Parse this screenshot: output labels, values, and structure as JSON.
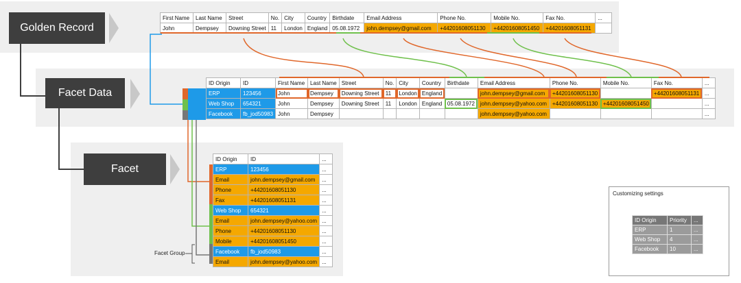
{
  "labels": {
    "golden": "Golden Record",
    "facet_data": "Facet Data",
    "facet": "Facet",
    "facet_group": "Facet Group"
  },
  "golden": {
    "headers": [
      "First Name",
      "Last Name",
      "Street",
      "No.",
      "City",
      "Country",
      "Birthdate",
      "Email Address",
      "Phone No.",
      "Mobile No.",
      "Fax No.",
      "..."
    ],
    "row": [
      "John",
      "Dempsey",
      "Downing Street",
      "11",
      "London",
      "England",
      "05.08.1972",
      "john.dempsey@gmail.com",
      "+44201608051130",
      "+44201608051450",
      "+44201608051131",
      ""
    ]
  },
  "facet_data": {
    "headers": [
      "ID Origin",
      "ID",
      "First Name",
      "Last Name",
      "Street",
      "No.",
      "City",
      "Country",
      "Birthdate",
      "Email Address",
      "Phone No.",
      "Mobile No.",
      "Fax No.",
      "..."
    ],
    "rows": [
      [
        "ERP",
        "123456",
        "John",
        "Dempsey",
        "Downing Street",
        "11",
        "London",
        "England",
        "",
        "john.dempsey@gmail.com",
        "+44201608051130",
        "",
        "+44201608051131",
        "..."
      ],
      [
        "Web Shop",
        "654321",
        "John",
        "Dempsey",
        "Downing Street",
        "11",
        "London",
        "England",
        "05.08.1972",
        "john.dempsey@yahoo.com",
        "+44201608051130",
        "+44201608051450",
        "",
        "..."
      ],
      [
        "Facebook",
        "fb_jod50983",
        "John",
        "Dempsey",
        "",
        "",
        "",
        "",
        "",
        "john.dempsey@yahoo.com",
        "",
        "",
        "",
        "..."
      ]
    ]
  },
  "facet": {
    "headers": [
      "ID Origin",
      "ID",
      "..."
    ],
    "rows": [
      [
        "ERP",
        "123456",
        "..."
      ],
      [
        "Email",
        "john.dempsey@gmail.com",
        "..."
      ],
      [
        "Phone",
        "+44201608051130",
        "..."
      ],
      [
        "Fax",
        "+44201608051131",
        "..."
      ],
      [
        "Web Shop",
        "654321",
        "..."
      ],
      [
        "Email",
        "john.dempsey@yahoo.com",
        "..."
      ],
      [
        "Phone",
        "+44201608051130",
        "..."
      ],
      [
        "Mobile",
        "+44201608051450",
        "..."
      ],
      [
        "Facebook",
        "fb_jod50983",
        "..."
      ],
      [
        "Email",
        "john.dempsey@yahoo.com",
        "..."
      ]
    ]
  },
  "customizing": {
    "title": "Customizing settings",
    "headers": [
      "ID Origin",
      "Priority",
      "..."
    ],
    "rows": [
      [
        "ERP",
        "1",
        "..."
      ],
      [
        "Web Shop",
        "4",
        "..."
      ],
      [
        "Facebook",
        "10",
        "..."
      ]
    ]
  },
  "colors": {
    "orange": "#f5a800",
    "blue": "#1e9ae8",
    "red_line": "#e0672a",
    "green_line": "#6fc04b",
    "dark": "#3e3e3e"
  }
}
